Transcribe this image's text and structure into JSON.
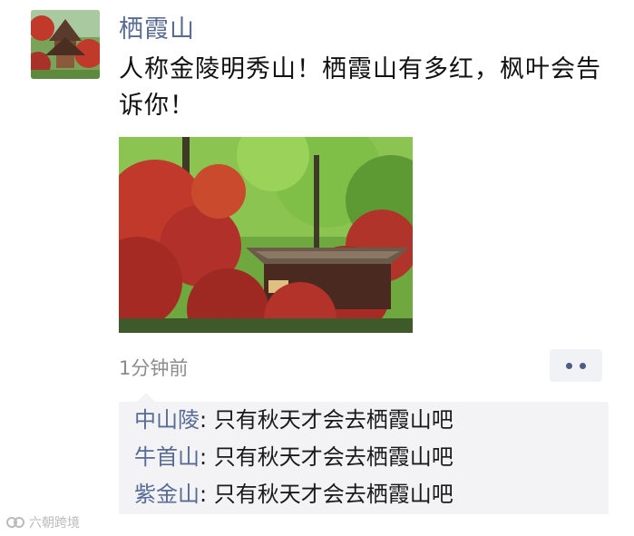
{
  "post": {
    "author": "栖霞山",
    "text": "人称金陵明秀山！栖霞山有多红，枫叶会告诉你！",
    "time": "1分钟前"
  },
  "comments": [
    {
      "author": "中山陵",
      "separator": ": ",
      "text": "只有秋天才会去栖霞山吧"
    },
    {
      "author": "牛首山",
      "separator": ": ",
      "text": "只有秋天才会去栖霞山吧"
    },
    {
      "author": "紫金山",
      "separator": ": ",
      "text": "只有秋天才会去栖霞山吧"
    }
  ],
  "watermark": {
    "text": "六朝跨境"
  },
  "colors": {
    "link": "#576b95",
    "comment_bg": "#f3f3f5",
    "time": "#8c8c8c"
  },
  "icons": {
    "more": "more-dots-icon",
    "watermark": "watermark-logo-icon"
  }
}
